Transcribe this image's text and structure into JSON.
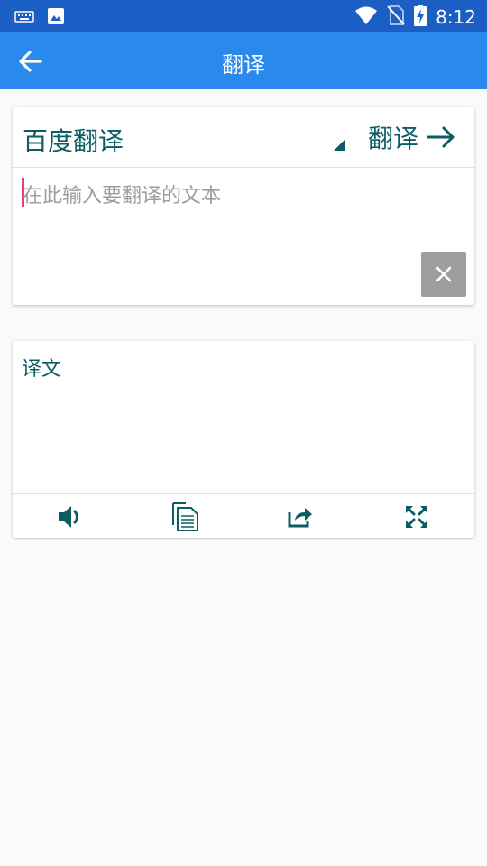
{
  "status_bar": {
    "time": "8:12",
    "icons": [
      "keyboard-icon",
      "image-icon",
      "wifi-icon",
      "no-sim-icon",
      "battery-charging-icon"
    ]
  },
  "app_bar": {
    "title": "翻译",
    "back_icon": "arrow-left-icon"
  },
  "input_card": {
    "engine": "百度翻译",
    "translate_label": "翻译",
    "placeholder": "在此输入要翻译的文本",
    "clear_icon": "close-icon"
  },
  "output_card": {
    "label": "译文",
    "actions": [
      "speaker-icon",
      "copy-icon",
      "share-icon",
      "fullscreen-icon"
    ]
  },
  "colors": {
    "status_bar": "#1c5fc4",
    "app_bar": "#2989ec",
    "accent_text": "#0b5d63",
    "cursor": "#e0417a",
    "clear_button": "#9e9e9e"
  }
}
